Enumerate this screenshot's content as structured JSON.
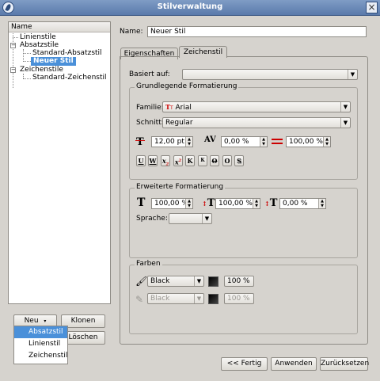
{
  "window": {
    "title": "Stilverwaltung"
  },
  "tree": {
    "header": "Name",
    "items": [
      "Linienstile",
      "Absatzstile",
      "Standard-Absatzstil",
      "Neuer Stil",
      "Zeichenstile",
      "Standard-Zeichenstil"
    ],
    "selected": "Neuer Stil"
  },
  "buttons": {
    "new": "Neu",
    "clone": "Klonen",
    "delete": "Löschen",
    "done": "<< Fertig",
    "apply": "Anwenden",
    "reset": "Zurücksetzen"
  },
  "new_menu": {
    "items": [
      "Absatzstil",
      "Linienstil",
      "Zeichenstil"
    ],
    "selected": "Absatzstil"
  },
  "name": {
    "label": "Name:",
    "value": "Neuer Stil"
  },
  "tabs": [
    "Eigenschaften",
    "Zeichenstil"
  ],
  "active_tab": "Zeichenstil",
  "based_on": {
    "label": "Basiert auf:",
    "value": ""
  },
  "basic": {
    "title": "Grundlegende Formatierung",
    "family_label": "Familie:",
    "family_value": "Arial",
    "style_label": "Schnitt:",
    "style_value": "Regular",
    "size": "12,00 pt",
    "tracking": "0,00 %",
    "scale_h": "100,00 %",
    "format_buttons": [
      "U",
      "W",
      "x",
      "x",
      "K",
      "K",
      "O",
      "O",
      "S"
    ]
  },
  "advanced": {
    "title": "Erweiterte Formatierung",
    "scale_w": "100,00 %",
    "scale_v": "100,00 %",
    "baseline": "0,00 %",
    "language_label": "Sprache:",
    "language_value": ""
  },
  "colors": {
    "title": "Farben",
    "fill_color": "Black",
    "fill_shade": "100 %",
    "stroke_color": "Black",
    "stroke_shade": "100 %"
  }
}
